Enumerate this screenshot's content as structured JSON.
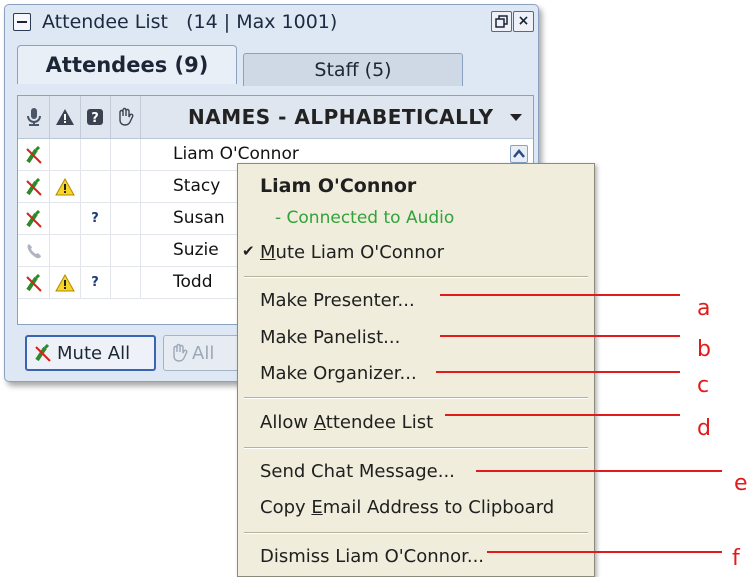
{
  "panel": {
    "title": "Attendee List",
    "count_text": "(14 | Max 1001)",
    "restore_icon": "restore-icon",
    "close_glyph": "×",
    "tabs": [
      {
        "label": "Attendees (9)",
        "active": true
      },
      {
        "label": "Staff (5)",
        "active": false
      }
    ],
    "header_icons": [
      "microphone-icon",
      "warning-icon",
      "question-icon",
      "raised-hand-icon"
    ],
    "header_title": "NAMES - ALPHABETICALLY",
    "rows": [
      {
        "name": "Liam O'Connor",
        "audio": "muted-mic",
        "warning": false,
        "question": false
      },
      {
        "name": "Stacy",
        "audio": "muted-mic",
        "warning": true,
        "question": false
      },
      {
        "name": "Susan",
        "audio": "muted-mic",
        "warning": false,
        "question": true
      },
      {
        "name": "Suzie",
        "audio": "phone",
        "warning": false,
        "question": false
      },
      {
        "name": "Todd",
        "audio": "muted-mic",
        "warning": true,
        "question": true
      }
    ],
    "question_glyph": "?",
    "mute_all_label": "Mute All",
    "all_label": "All"
  },
  "menu": {
    "title": "Liam O'Connor",
    "status": "- Connected to Audio",
    "check_glyph": "✔",
    "mute": {
      "before": "",
      "accel": "M",
      "after": "ute Liam O'Connor"
    },
    "make_presenter": "Make Presenter...",
    "make_panelist": "Make Panelist...",
    "make_organizer": "Make Organizer...",
    "allow_list": {
      "before": "Allow ",
      "accel": "A",
      "after": "ttendee List"
    },
    "send_chat": "Send Chat Message...",
    "copy_email": {
      "before": "Copy ",
      "accel": "E",
      "after": "mail Address to Clipboard"
    },
    "dismiss": "Dismiss Liam O'Connor..."
  },
  "callouts": [
    "a",
    "b",
    "c",
    "d",
    "e",
    "f"
  ],
  "colors": {
    "callout": "#e11b1b",
    "connected": "#31a33a",
    "menu_bg": "#f0eddc",
    "panel_bg": "#dde8f4"
  }
}
